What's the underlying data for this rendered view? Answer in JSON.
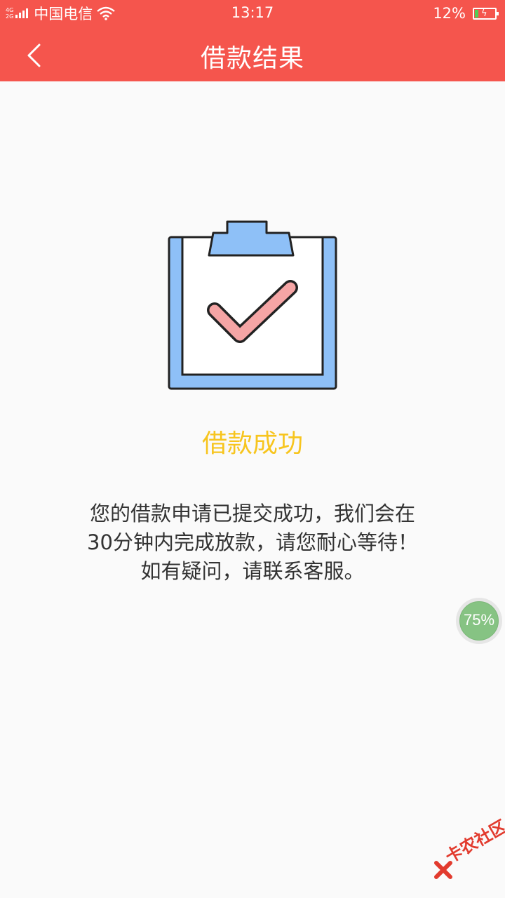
{
  "status_bar": {
    "network_tags": [
      "4G",
      "2G"
    ],
    "carrier": "中国电信",
    "time": "13:17",
    "battery_percent": "12%",
    "icons": [
      "signal-icon",
      "wifi-icon",
      "battery-charging-icon"
    ]
  },
  "nav": {
    "back_icon": "chevron-left-icon",
    "title": "借款结果"
  },
  "result": {
    "icon": "clipboard-check-icon",
    "title": "借款成功",
    "message_lines": [
      "您的借款申请已提交成功，我们会在",
      "30分钟内完成放款，请您耐心等待！",
      "如有疑问，请联系客服。"
    ]
  },
  "float_ball": {
    "label": "75%"
  },
  "watermark": {
    "text": "卡农社区"
  },
  "colors": {
    "header": "#f5554d",
    "result_title": "#f7c51e",
    "message_text": "#333333",
    "clipboard_blue": "#8ec0f7",
    "check_pink": "#f5a5a5",
    "float_ball_green": "#86c383"
  }
}
